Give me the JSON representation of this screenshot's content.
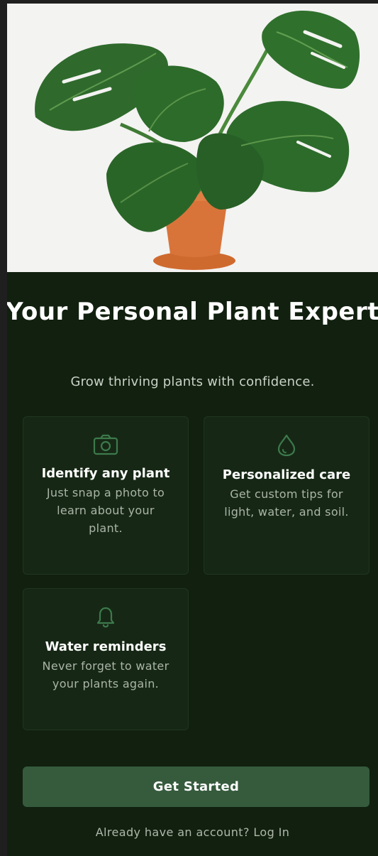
{
  "hero": {
    "image": "monstera-plant-in-terracotta-pot"
  },
  "title": "Your Personal Plant Expert",
  "subtitle": "Grow thriving plants with confidence.",
  "features": [
    {
      "icon": "camera-icon",
      "title": "Identify any plant",
      "desc": "Just snap a photo to learn about your plant."
    },
    {
      "icon": "water-drop-icon",
      "title": "Personalized care",
      "desc": "Get custom tips for light, water, and soil."
    },
    {
      "icon": "bell-icon",
      "title": "Water reminders",
      "desc": "Never forget to water your plants again."
    }
  ],
  "cta": {
    "label": "Get Started"
  },
  "login": {
    "text": "Already have an account? Log In"
  },
  "colors": {
    "background": "#11200f",
    "card": "#162815",
    "accent": "#355b3c",
    "icon": "#3d7a4c"
  }
}
